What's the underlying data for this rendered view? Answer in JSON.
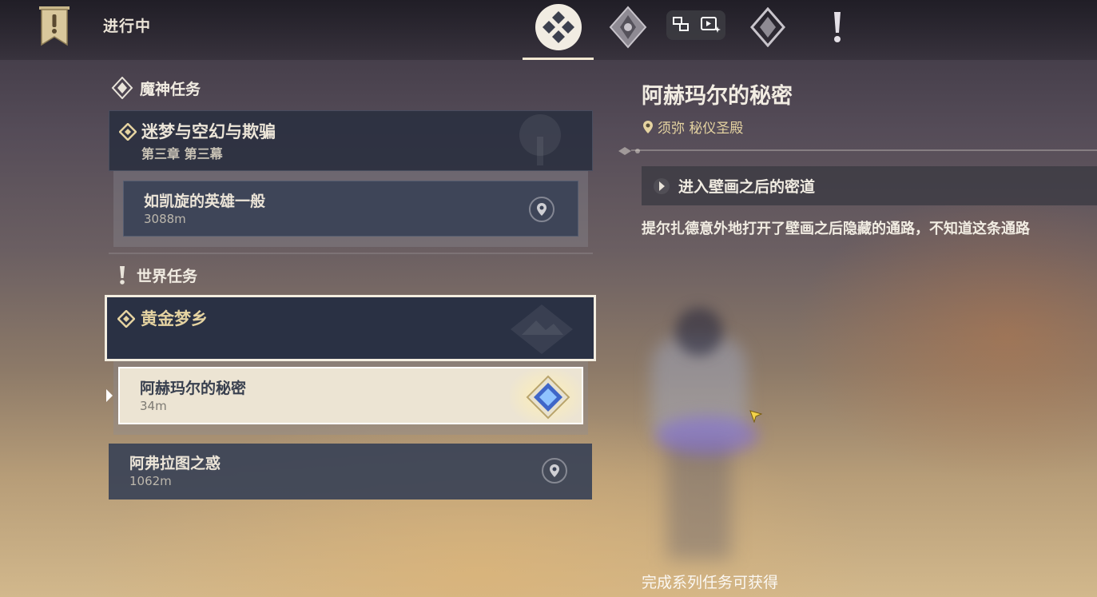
{
  "header": {
    "title": "进行中",
    "tabs": [
      {
        "icon": "all-quests-icon",
        "active": true
      },
      {
        "icon": "archon-quest-icon",
        "active": false
      },
      {
        "icon": "story-quest-icon",
        "active": false
      },
      {
        "icon": "world-quest-icon",
        "active": false
      }
    ]
  },
  "quest_list": {
    "sections": [
      {
        "heading": "魔神任务",
        "quest": {
          "title": "迷梦与空幻与欺骗",
          "subtitle": "第三章 第三幕"
        },
        "items": [
          {
            "name": "如凯旋的英雄一般",
            "distance": "3088m"
          }
        ]
      },
      {
        "heading": "世界任务",
        "quest": {
          "title": "黄金梦乡"
        },
        "items": [
          {
            "name": "阿赫玛尔的秘密",
            "distance": "34m"
          },
          {
            "name": "阿弗拉图之惑",
            "distance": "1062m"
          }
        ]
      }
    ]
  },
  "detail": {
    "title": "阿赫玛尔的秘密",
    "location": "须弥 秘仪圣殿",
    "step": "进入壁画之后的密道",
    "description": "提尔扎德意外地打开了壁画之后隐藏的通路，不知道这条通路",
    "footer": "完成系列任务可获得"
  },
  "colors": {
    "accent_gold": "#e5d3a1",
    "selected_bg": "#ece4d3",
    "card_bg": "#2a3144",
    "waypoint_blue": "#4a7de0"
  }
}
